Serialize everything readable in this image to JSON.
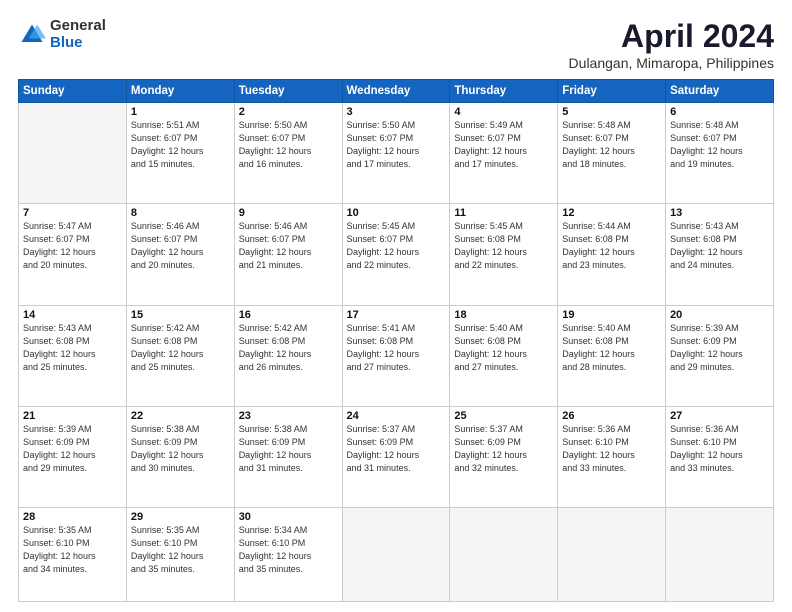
{
  "logo": {
    "general": "General",
    "blue": "Blue"
  },
  "header": {
    "month": "April 2024",
    "location": "Dulangan, Mimaropa, Philippines"
  },
  "weekdays": [
    "Sunday",
    "Monday",
    "Tuesday",
    "Wednesday",
    "Thursday",
    "Friday",
    "Saturday"
  ],
  "weeks": [
    [
      {
        "day": "",
        "empty": true
      },
      {
        "day": "1",
        "sunrise": "5:51 AM",
        "sunset": "6:07 PM",
        "daylight": "12 hours and 15 minutes."
      },
      {
        "day": "2",
        "sunrise": "5:50 AM",
        "sunset": "6:07 PM",
        "daylight": "12 hours and 16 minutes."
      },
      {
        "day": "3",
        "sunrise": "5:50 AM",
        "sunset": "6:07 PM",
        "daylight": "12 hours and 17 minutes."
      },
      {
        "day": "4",
        "sunrise": "5:49 AM",
        "sunset": "6:07 PM",
        "daylight": "12 hours and 17 minutes."
      },
      {
        "day": "5",
        "sunrise": "5:48 AM",
        "sunset": "6:07 PM",
        "daylight": "12 hours and 18 minutes."
      },
      {
        "day": "6",
        "sunrise": "5:48 AM",
        "sunset": "6:07 PM",
        "daylight": "12 hours and 19 minutes."
      }
    ],
    [
      {
        "day": "7",
        "sunrise": "5:47 AM",
        "sunset": "6:07 PM",
        "daylight": "12 hours and 20 minutes."
      },
      {
        "day": "8",
        "sunrise": "5:46 AM",
        "sunset": "6:07 PM",
        "daylight": "12 hours and 20 minutes."
      },
      {
        "day": "9",
        "sunrise": "5:46 AM",
        "sunset": "6:07 PM",
        "daylight": "12 hours and 21 minutes."
      },
      {
        "day": "10",
        "sunrise": "5:45 AM",
        "sunset": "6:07 PM",
        "daylight": "12 hours and 22 minutes."
      },
      {
        "day": "11",
        "sunrise": "5:45 AM",
        "sunset": "6:08 PM",
        "daylight": "12 hours and 22 minutes."
      },
      {
        "day": "12",
        "sunrise": "5:44 AM",
        "sunset": "6:08 PM",
        "daylight": "12 hours and 23 minutes."
      },
      {
        "day": "13",
        "sunrise": "5:43 AM",
        "sunset": "6:08 PM",
        "daylight": "12 hours and 24 minutes."
      }
    ],
    [
      {
        "day": "14",
        "sunrise": "5:43 AM",
        "sunset": "6:08 PM",
        "daylight": "12 hours and 25 minutes."
      },
      {
        "day": "15",
        "sunrise": "5:42 AM",
        "sunset": "6:08 PM",
        "daylight": "12 hours and 25 minutes."
      },
      {
        "day": "16",
        "sunrise": "5:42 AM",
        "sunset": "6:08 PM",
        "daylight": "12 hours and 26 minutes."
      },
      {
        "day": "17",
        "sunrise": "5:41 AM",
        "sunset": "6:08 PM",
        "daylight": "12 hours and 27 minutes."
      },
      {
        "day": "18",
        "sunrise": "5:40 AM",
        "sunset": "6:08 PM",
        "daylight": "12 hours and 27 minutes."
      },
      {
        "day": "19",
        "sunrise": "5:40 AM",
        "sunset": "6:08 PM",
        "daylight": "12 hours and 28 minutes."
      },
      {
        "day": "20",
        "sunrise": "5:39 AM",
        "sunset": "6:09 PM",
        "daylight": "12 hours and 29 minutes."
      }
    ],
    [
      {
        "day": "21",
        "sunrise": "5:39 AM",
        "sunset": "6:09 PM",
        "daylight": "12 hours and 29 minutes."
      },
      {
        "day": "22",
        "sunrise": "5:38 AM",
        "sunset": "6:09 PM",
        "daylight": "12 hours and 30 minutes."
      },
      {
        "day": "23",
        "sunrise": "5:38 AM",
        "sunset": "6:09 PM",
        "daylight": "12 hours and 31 minutes."
      },
      {
        "day": "24",
        "sunrise": "5:37 AM",
        "sunset": "6:09 PM",
        "daylight": "12 hours and 31 minutes."
      },
      {
        "day": "25",
        "sunrise": "5:37 AM",
        "sunset": "6:09 PM",
        "daylight": "12 hours and 32 minutes."
      },
      {
        "day": "26",
        "sunrise": "5:36 AM",
        "sunset": "6:10 PM",
        "daylight": "12 hours and 33 minutes."
      },
      {
        "day": "27",
        "sunrise": "5:36 AM",
        "sunset": "6:10 PM",
        "daylight": "12 hours and 33 minutes."
      }
    ],
    [
      {
        "day": "28",
        "sunrise": "5:35 AM",
        "sunset": "6:10 PM",
        "daylight": "12 hours and 34 minutes."
      },
      {
        "day": "29",
        "sunrise": "5:35 AM",
        "sunset": "6:10 PM",
        "daylight": "12 hours and 35 minutes."
      },
      {
        "day": "30",
        "sunrise": "5:34 AM",
        "sunset": "6:10 PM",
        "daylight": "12 hours and 35 minutes."
      },
      {
        "day": "",
        "empty": true
      },
      {
        "day": "",
        "empty": true
      },
      {
        "day": "",
        "empty": true
      },
      {
        "day": "",
        "empty": true
      }
    ]
  ],
  "labels": {
    "sunrise_prefix": "Sunrise: ",
    "sunset_prefix": "Sunset: ",
    "daylight_prefix": "Daylight: "
  }
}
